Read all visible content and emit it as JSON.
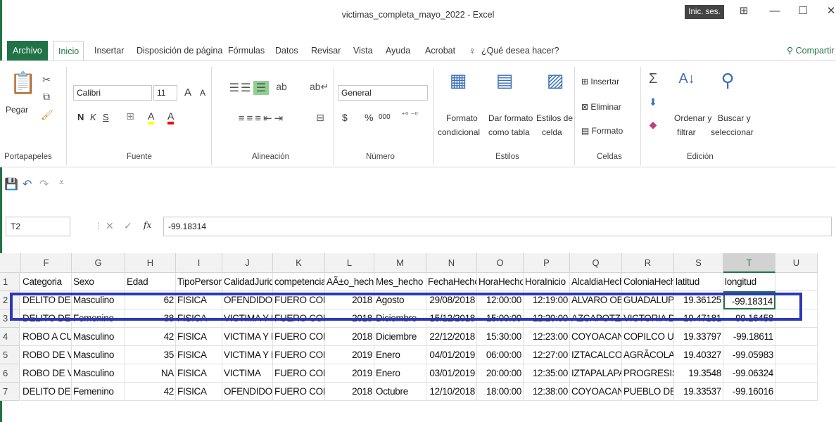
{
  "window": {
    "title": "victimas_completa_mayo_2022  -  Excel",
    "sign_in": "Inic. ses.",
    "controls": {
      "ribbon_display": "⊞",
      "minimize": "—",
      "maximize": "☐",
      "close": "✕"
    }
  },
  "tabs": [
    "Archivo",
    "Inicio",
    "Insertar",
    "Disposición de página",
    "Fórmulas",
    "Datos",
    "Revisar",
    "Vista",
    "Ayuda",
    "Acrobat"
  ],
  "tell_me": "¿Qué desea hacer?",
  "share": "Compartir",
  "ribbon": {
    "clipboard": {
      "paste": "Pegar",
      "label": "Portapapeles"
    },
    "font": {
      "name": "Calibri",
      "size": "11",
      "bold": "N",
      "italic": "K",
      "underline": "S",
      "grow": "A",
      "shrink": "A",
      "fill": "A",
      "color": "A",
      "label": "Fuente"
    },
    "alignment": {
      "label": "Alineación"
    },
    "number": {
      "format": "General",
      "currency": "$",
      "percent": "%",
      "thousands": "000",
      "label": "Número"
    },
    "styles": {
      "conditional": [
        "Formato",
        "condicional"
      ],
      "table": [
        "Dar formato",
        "como tabla"
      ],
      "cell": [
        "Estilos de",
        "celda"
      ],
      "label": "Estilos"
    },
    "cells": {
      "insert": "Insertar",
      "delete": "Eliminar",
      "format": "Formato",
      "label": "Celdas"
    },
    "editing": {
      "sort": [
        "Ordenar y",
        "filtrar"
      ],
      "find": [
        "Buscar y",
        "seleccionar"
      ],
      "label": "Edición"
    }
  },
  "formula_bar": {
    "name_box": "T2",
    "fx": "fx",
    "value": "-99.18314"
  },
  "columns": [
    {
      "letter": "F"
    },
    {
      "letter": "G"
    },
    {
      "letter": "H"
    },
    {
      "letter": "I"
    },
    {
      "letter": "J"
    },
    {
      "letter": "K"
    },
    {
      "letter": "L"
    },
    {
      "letter": "M"
    },
    {
      "letter": "N"
    },
    {
      "letter": "O"
    },
    {
      "letter": "P"
    },
    {
      "letter": "Q"
    },
    {
      "letter": "R"
    },
    {
      "letter": "S"
    },
    {
      "letter": "T"
    },
    {
      "letter": "U"
    }
  ],
  "rows": [
    {
      "num": "1",
      "cells": [
        "Categoria",
        "Sexo",
        "Edad",
        "TipoPersona",
        "CalidadJuridica",
        "competencia",
        "AÃ±o_hecho",
        "Mes_hecho",
        "FechaHecho",
        "HoraHecho",
        "HoraInicio",
        "AlcaldiaHecho",
        "ColoniaHecho",
        "latitud",
        "longitud",
        ""
      ]
    },
    {
      "num": "2",
      "cells": [
        "DELITO DE BAJO IMPACTO",
        "Masculino",
        "62",
        "FISICA",
        "OFENDIDO",
        "FUERO COMUN",
        "2018",
        "Agosto",
        "29/08/2018",
        "12:00:00",
        "12:19:00",
        "ALVARO OBREGON",
        "GUADALUPE",
        "19.36125",
        "-99.18314",
        ""
      ]
    },
    {
      "num": "3",
      "cells": [
        "DELITO DE BAJO IMPACTO",
        "Femenino",
        "38",
        "FISICA",
        "VICTIMA Y DENUNCIANTE",
        "FUERO COMUN",
        "2018",
        "Diciembre",
        "15/12/2018",
        "15:00:00",
        "12:20:00",
        "AZCAPOTZALCO",
        "VICTORIA DE LAS DEMOCRACIAS",
        "19.47181",
        "-99.16458",
        ""
      ]
    },
    {
      "num": "4",
      "cells": [
        "ROBO A CUENTAHABIENTE",
        "Masculino",
        "42",
        "FISICA",
        "VICTIMA Y DENUNCIANTE",
        "FUERO COMUN",
        "2018",
        "Diciembre",
        "22/12/2018",
        "15:30:00",
        "12:23:00",
        "COYOACAN",
        "COPILCO UNIVERSIDAD",
        "19.33797",
        "-99.18611",
        ""
      ]
    },
    {
      "num": "5",
      "cells": [
        "ROBO DE VEHICULO",
        "Masculino",
        "35",
        "FISICA",
        "VICTIMA Y DENUNCIANTE",
        "FUERO COMUN",
        "2019",
        "Enero",
        "04/01/2019",
        "06:00:00",
        "12:27:00",
        "IZTACALCO",
        "AGRÃCOLA ORIENTAL",
        "19.40327",
        "-99.05983",
        ""
      ]
    },
    {
      "num": "6",
      "cells": [
        "ROBO DE VEHICULO",
        "Masculino",
        "NA",
        "FISICA",
        "VICTIMA",
        "FUERO COMUN",
        "2019",
        "Enero",
        "03/01/2019",
        "20:00:00",
        "12:35:00",
        "IZTAPALAPA",
        "PROGRESISTA",
        "19.3548",
        "-99.06324",
        ""
      ]
    },
    {
      "num": "7",
      "cells": [
        "DELITO DE BAJO IMPACTO",
        "Femenino",
        "42",
        "FISICA",
        "OFENDIDO",
        "FUERO COMUN",
        "2018",
        "Octubre",
        "12/10/2018",
        "18:00:00",
        "12:38:00",
        "COYOACAN",
        "PUEBLO DE LOS REYES",
        "19.33537",
        "-99.16016",
        ""
      ]
    }
  ]
}
